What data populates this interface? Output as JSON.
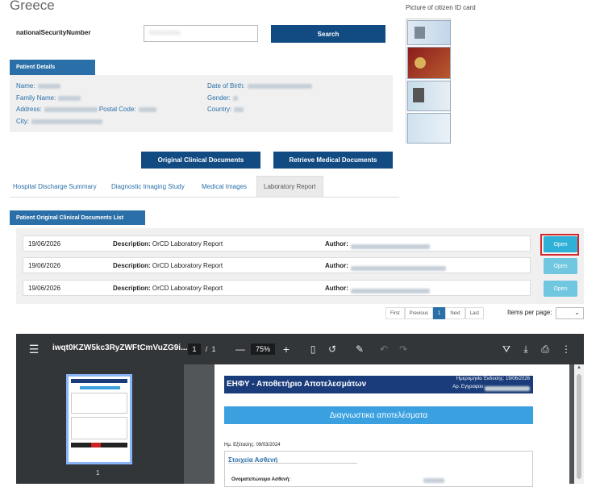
{
  "header": {
    "country": "Greece",
    "nsn_label": "nationalSecurityNumber",
    "nsn_value": "0101010101",
    "search_label": "Search",
    "picture_label": "Picture of citizen ID card"
  },
  "patient": {
    "section_title": "Patient Details",
    "name_label": "Name:",
    "family_label": "Family Name:",
    "address_label": "Address:",
    "postal_label": "Postal Code:",
    "city_label": "City:",
    "dob_label": "Date of Birth:",
    "gender_label": "Gender:",
    "country_label": "Country:"
  },
  "actions": {
    "original_label": "Original Clinical Documents",
    "retrieve_label": "Retrieve Medical Documents"
  },
  "tabs": [
    {
      "label": "Hospital Discharge Summary"
    },
    {
      "label": "Diagnostic Imaging Study"
    },
    {
      "label": "Medical Images"
    },
    {
      "label": "Laboratory Report",
      "active": true
    }
  ],
  "documents": {
    "section_title": "Patient Original Clinical Documents List",
    "description_label": "Description:",
    "author_label": "Author:",
    "open_label": "Open",
    "rows": [
      {
        "date": "19/06/2026",
        "description": "OrCD Laboratory Report"
      },
      {
        "date": "19/06/2026",
        "description": "OrCD Laboratory Report"
      },
      {
        "date": "19/06/2026",
        "description": "OrCD Laboratory Report"
      }
    ]
  },
  "pagination": {
    "first": "First",
    "previous": "Previous",
    "current": "1",
    "next": "Next",
    "last": "Last",
    "ipp_label": "Items per page:"
  },
  "pdf": {
    "filename": "iwqt0KZW5kc3RyZWFtCmVuZG9i...",
    "page_current": "1",
    "page_sep": "/",
    "page_total": "1",
    "minus": "—",
    "zoom": "75%",
    "plus": "+",
    "thumb_page": "1",
    "doc_title": "ΕΗΦΥ - Αποθετήριο Αποτελεσμάτων",
    "issue_date": "Ημερομηνία Έκδοσης: 19/06/2026",
    "reg_no": "Αρ. Εγγραφου:",
    "banner": "Διαγνωστικα αποτελέσματα",
    "exam_date": "Ημ. Εξέτασης: 09/03/2024",
    "patient_section": "Στοιχεία Ασθενή",
    "fullname_label": "Ονοματεπώνυμο Ασθενή:"
  },
  "colors": {
    "brand_dark": "#114b82",
    "brand": "#2a6fa8",
    "open_button": "#5bc0de",
    "highlight": "#d9262b"
  }
}
